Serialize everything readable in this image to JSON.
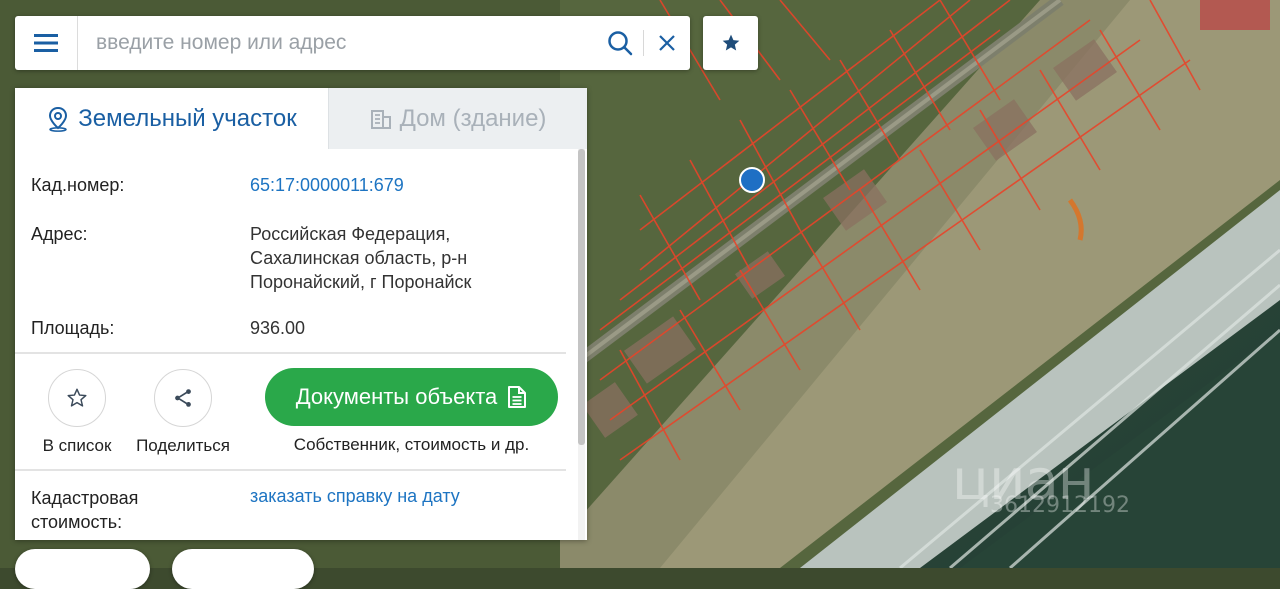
{
  "search": {
    "placeholder": "введите номер или адрес"
  },
  "tabs": [
    {
      "label": "Земельный участок",
      "active": true,
      "icon": "map-pin-icon"
    },
    {
      "label": "Дом (здание)",
      "active": false,
      "icon": "building-icon"
    }
  ],
  "details": {
    "cadastral_label": "Кад.номер:",
    "cadastral_value": "65:17:0000011:679",
    "address_label": "Адрес:",
    "address_line1": "Российская Федерация,",
    "address_line2": "Сахалинская область, р-н",
    "address_line3": "Поронайский, г Поронайск",
    "area_label": "Площадь:",
    "area_value": "936.00"
  },
  "actions": {
    "to_list_label": "В список",
    "share_label": "Поделиться",
    "documents_label": "Документы объекта",
    "documents_sub": "Собственник, стоимость и др."
  },
  "cadastral_cost": {
    "label_line1": "Кадастровая",
    "label_line2": "стоимость:",
    "link": "заказать справку на дату"
  },
  "watermark": {
    "brand": "циан",
    "id": "3612912192"
  },
  "colors": {
    "brand_blue": "#1a5fa3",
    "link_blue": "#1d74c2",
    "green_button": "#2aa84a",
    "parcel_lines": "#e8442a",
    "marker": "#1e6fc4"
  }
}
